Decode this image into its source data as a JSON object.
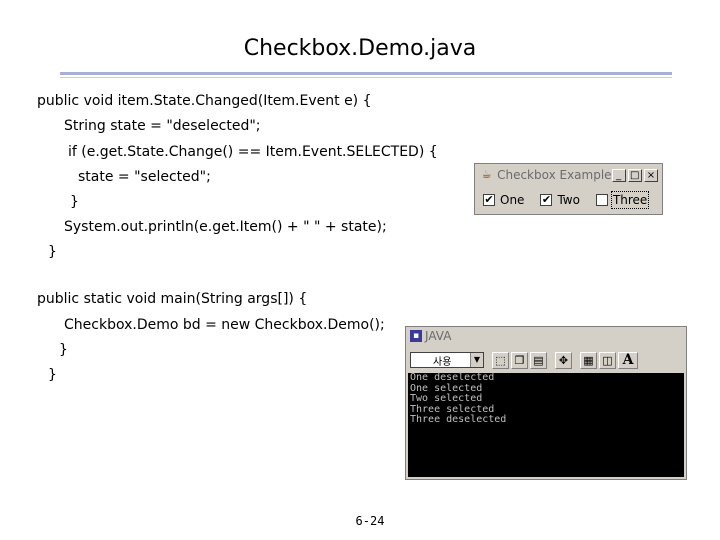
{
  "slide": {
    "title": "Checkbox.Demo.java",
    "page_number": "6-24"
  },
  "code_lines": [
    {
      "text": "public void item.State.Changed(Item.Event e) {"
    },
    {
      "text": "String state = \"deselected\";"
    },
    {
      "text": "if (e.get.State.Change() == Item.Event.SELECTED) {"
    },
    {
      "text": "state = \"selected\";"
    },
    {
      "text": "}"
    },
    {
      "text": "System.out.println(e.get.Item() + \" \" + state);"
    },
    {
      "text": "}"
    },
    {
      "text": "public static void main(String args[]) {"
    },
    {
      "text": "Checkbox.Demo bd = new Checkbox.Demo();"
    },
    {
      "text": "}"
    },
    {
      "text": "}"
    }
  ],
  "checkbox_window": {
    "title": "Checkbox Example",
    "buttons": {
      "minimize": "_",
      "maximize": "□",
      "close": "×"
    },
    "items": [
      {
        "label": "One",
        "checked": true,
        "mark": "✔"
      },
      {
        "label": "Two",
        "checked": true,
        "mark": "✔"
      },
      {
        "label": "Three",
        "checked": false,
        "mark": ""
      }
    ]
  },
  "console_window": {
    "title": "JAVA",
    "font_select": "사용",
    "toolbar_big_a": "A",
    "output_lines": [
      "One deselected",
      "One selected",
      "Two selected",
      "Three selected",
      "Three deselected"
    ]
  },
  "colors": {
    "rule": "#a9aed6",
    "window_face": "#d4d0c8",
    "console_bg": "#000000",
    "console_fg": "#c0c0c0"
  }
}
